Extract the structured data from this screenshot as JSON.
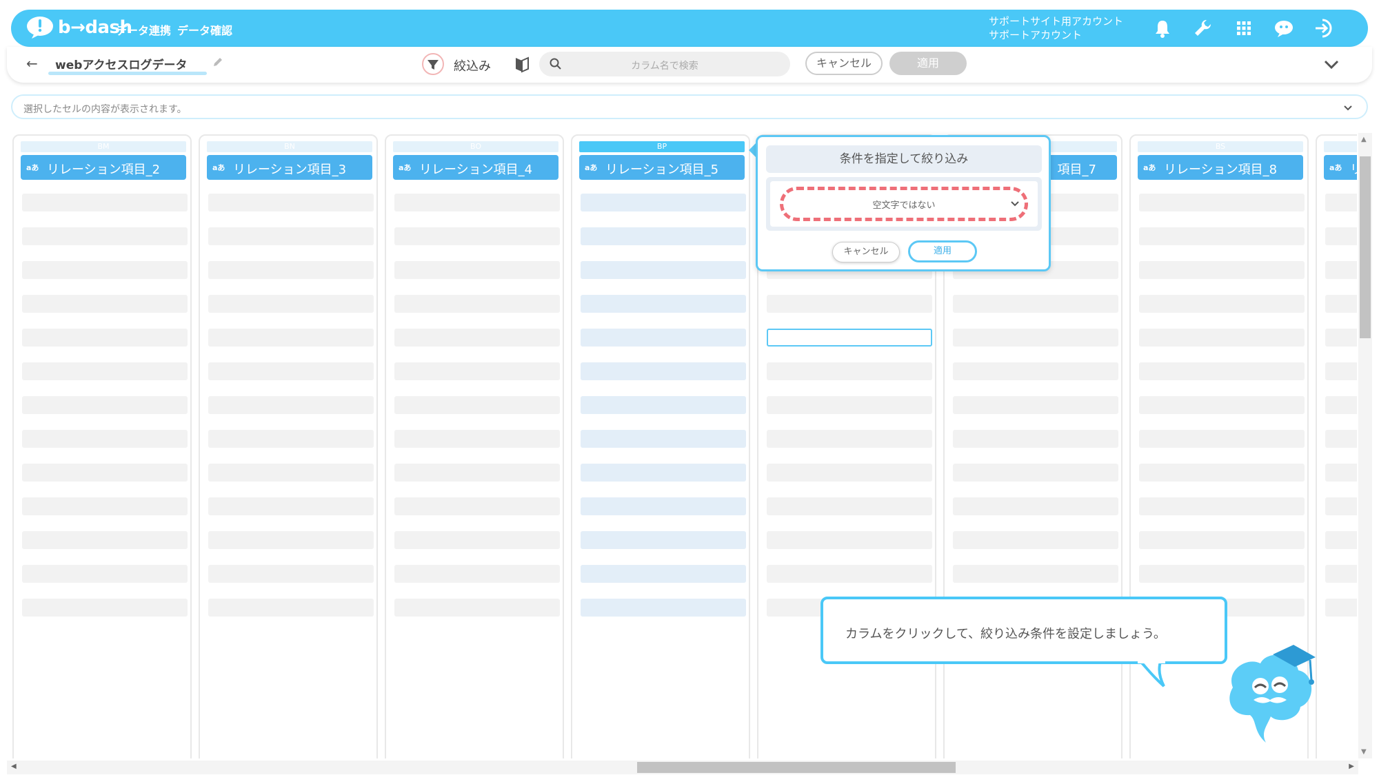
{
  "header": {
    "logo_text": "b→dash",
    "nav": [
      "データ連携",
      "データ確認"
    ],
    "account_line1": "サポートサイト用アカウント",
    "account_line2": "サポートアカウント",
    "icons": [
      "bell-icon",
      "wrench-icon",
      "apps-grid-icon",
      "chat-robot-icon",
      "logout-icon"
    ],
    "accent_color": "#4ac8f7"
  },
  "toolbar": {
    "back_icon": "arrow-left-icon",
    "title": "webアクセスログデータ",
    "filter_label": "絞込み",
    "search_placeholder": "カラム名で検索",
    "cancel_label": "キャンセル",
    "apply_label": "適用"
  },
  "cellbar": {
    "placeholder": "選択したセルの内容が表示されます。"
  },
  "columns": [
    {
      "letter": "BM",
      "type": "aあ",
      "name": "リレーション項目_2"
    },
    {
      "letter": "BN",
      "type": "aあ",
      "name": "リレーション項目_3"
    },
    {
      "letter": "BO",
      "type": "aあ",
      "name": "リレーション項目_4"
    },
    {
      "letter": "BP",
      "type": "aあ",
      "name": "リレーション項目_5"
    },
    {
      "letter": "",
      "type": "",
      "name": ""
    },
    {
      "letter": "",
      "type": "aあ",
      "name": "項目_7"
    },
    {
      "letter": "BS",
      "type": "aあ",
      "name": "リレーション項目_8"
    },
    {
      "letter": "",
      "type": "aあ",
      "name": "リ"
    }
  ],
  "popup": {
    "title": "条件を指定して絞り込み",
    "condition": "空文字ではない",
    "cancel_label": "キャンセル",
    "apply_label": "適用",
    "highlight_color": "#ee6f78"
  },
  "tooltip": {
    "text": "カラムをクリックして、絞り込み条件を設定しましょう。"
  }
}
